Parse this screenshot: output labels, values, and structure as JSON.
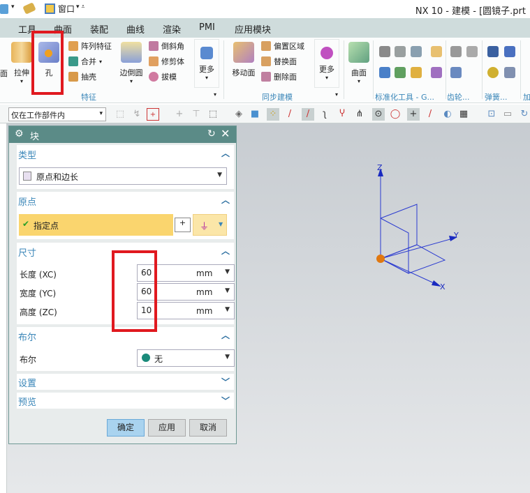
{
  "window": {
    "title": "NX 10 - 建模 - [圆镜子.prt",
    "qat_window": "窗口"
  },
  "menu_tabs": [
    "工具",
    "曲面",
    "装配",
    "曲线",
    "渲染",
    "PMI",
    "应用模块"
  ],
  "ribbon": {
    "partial_left": "面",
    "extrude": "拉伸",
    "hole": "孔",
    "feature_small": [
      "阵列特征",
      "合并",
      "抽壳"
    ],
    "edge_blend": "边倒圆",
    "feature_small2": [
      "倒斜角",
      "修剪体",
      "拔模"
    ],
    "more1": "更多",
    "feature_group": "特征",
    "move_face": "移动面",
    "sync_small": [
      "偏置区域",
      "替换面",
      "删除面"
    ],
    "more2": "更多",
    "sync_group": "同步建模",
    "surface": "曲面",
    "std_group": "标准化工具 - G...",
    "gear_group": "齿轮...",
    "spring_group": "弹簧...",
    "add_group": "加"
  },
  "toolbar": {
    "filter": "仅在工作部件内"
  },
  "dialog": {
    "title": "块",
    "type_section": "类型",
    "type_value": "原点和边长",
    "origin_section": "原点",
    "specify_point": "指定点",
    "dims_section": "尺寸",
    "dims": [
      {
        "label": "长度 (XC)",
        "value": "60",
        "unit": "mm"
      },
      {
        "label": "宽度 (YC)",
        "value": "60",
        "unit": "mm"
      },
      {
        "label": "高度 (ZC)",
        "value": "10",
        "unit": "mm"
      }
    ],
    "bool_section": "布尔",
    "bool_label": "布尔",
    "bool_value": "无",
    "settings_section": "设置",
    "preview_section": "预览",
    "ok": "确定",
    "apply": "应用",
    "cancel": "取消"
  },
  "axes": {
    "x": "X",
    "y": "Y",
    "z": "Z"
  },
  "colors": {
    "accent": "#3a86b8",
    "header": "#5b8b87",
    "highlight": "#fad56e",
    "red": "#e0191f"
  }
}
